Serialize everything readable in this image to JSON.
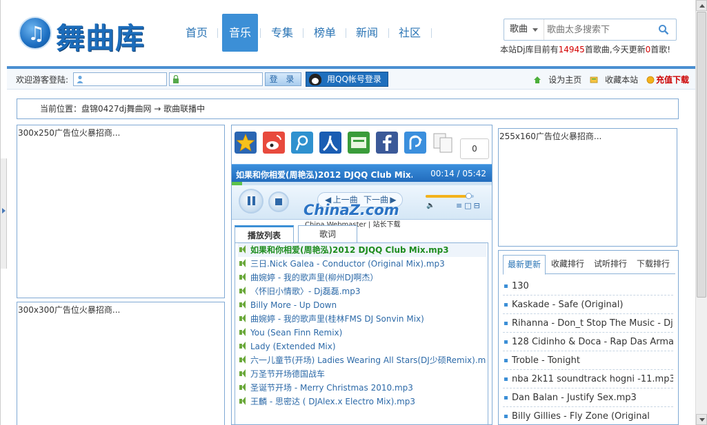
{
  "site": {
    "logo_text": "舞曲库",
    "logo_glyph": "♫"
  },
  "nav": {
    "items": [
      {
        "label": "首页"
      },
      {
        "label": "音乐"
      },
      {
        "label": "专集"
      },
      {
        "label": "榜单"
      },
      {
        "label": "新闻"
      },
      {
        "label": "社区"
      }
    ],
    "active_index": 1
  },
  "search": {
    "category": "歌曲",
    "placeholder": "歌曲太多搜索下"
  },
  "stats": {
    "prefix": "本站Dj库目前有",
    "total": "14945",
    "middle": "首歌曲,今天更新",
    "today": "0",
    "suffix": "首歌!"
  },
  "login": {
    "label": "欢迎游客登陆:",
    "login_button": "登 录",
    "qq_button": "用QQ帐号登录",
    "set_home": "设为主页",
    "bookmark": "收藏本站",
    "recharge": "充值下载"
  },
  "breadcrumb": "当前位置：盘锦0427dj舞曲网 → 歌曲联播中",
  "ads": {
    "left_top": "300x250广告位火暴招商...",
    "left_bottom": "300x300广告位火暴招商...",
    "right_top": "255x160广告位火暴招商..."
  },
  "player": {
    "share_count": "0",
    "now_playing": "如果和你相爱(周艳泓)2012 DJQQ Club Mix.mp3",
    "time": "00:14 / 05:42",
    "progress": 0.04,
    "volume": 0.9,
    "prev_label": "上一曲",
    "next_label": "下一曲",
    "watermark": "ChinaZ.com",
    "watermark_sub": "China Webmaster | 站长下载",
    "tabs": [
      "播放列表",
      "歌词"
    ],
    "active_tab": 0,
    "playlist": [
      "如果和你相爱(周艳泓)2012 DJQQ Club Mix.mp3",
      "三日.Nick Galea - Conductor (Original Mix).mp3",
      "曲婉婷 - 我的歌声里(柳州DJ啊杰）",
      "〈怀旧小情歌〉- Dj磊磊.mp3",
      "Billy More - Up Down",
      "曲婉婷 - 我的歌声里(桂林FMS DJ Sonvin Mix)",
      "You (Sean Finn Remix)",
      "Lady (Extended Mix)",
      "六一儿童节(开场) Ladies Wearing All Stars(DJ少硕Remix).mp3",
      "万圣节开场德国战车",
      "圣诞节开场 - Merry Christmas 2010.mp3",
      "王麟 - 思密达 ( DJAlex.x Electro Mix).mp3"
    ]
  },
  "rank": {
    "tabs": [
      "最新更新",
      "收藏排行",
      "试听排行",
      "下载排行"
    ],
    "active_tab": 0,
    "items": [
      "130",
      "Kaskade - Safe (Original)",
      "Rihanna - Don_t Stop The Music - Dj",
      "128 Cidinho & Doca - Rap Das Armas",
      "Troble - Tonight",
      "nba 2k11 soundtrack hogni -11.mp3",
      "Dan Balan - Justify Sex.mp3",
      "Billy Gillies - Fly Zone (Original"
    ]
  },
  "colors": {
    "brand_blue": "#1c6cba",
    "nav_active": "#3c8fd6",
    "highlight_red": "#d40000",
    "playing_green": "#1e8c1e"
  }
}
